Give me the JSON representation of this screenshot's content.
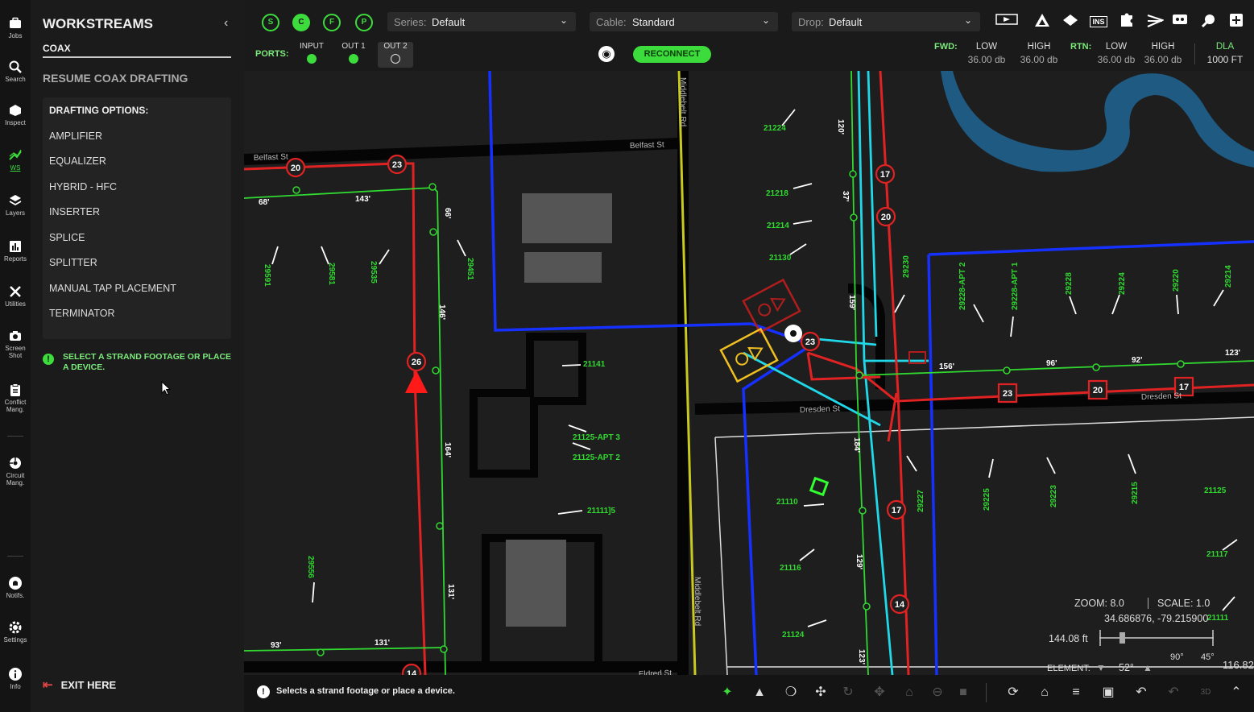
{
  "rail": {
    "items": [
      {
        "key": "jobs",
        "label": "Jobs",
        "icon": "briefcase-icon"
      },
      {
        "key": "search",
        "label": "Search",
        "icon": "search-icon"
      },
      {
        "key": "inspect",
        "label": "Inspect",
        "icon": "inspect-icon"
      },
      {
        "key": "ws",
        "label": "WS",
        "icon": "workstream-icon"
      },
      {
        "key": "layers",
        "label": "Layers",
        "icon": "layers-icon"
      },
      {
        "key": "reports",
        "label": "Reports",
        "icon": "reports-icon"
      },
      {
        "key": "utilities",
        "label": "Utilities",
        "icon": "tools-icon"
      },
      {
        "key": "screenshot",
        "label": "Screen Shot",
        "icon": "camera-icon"
      },
      {
        "key": "conflict",
        "label": "Conflict Mang.",
        "icon": "clipboard-icon"
      },
      {
        "key": "circuit",
        "label": "Circuit Mang.",
        "icon": "circuit-icon"
      },
      {
        "key": "notifs",
        "label": "Notifs.",
        "icon": "bell-icon"
      },
      {
        "key": "settings",
        "label": "Settings",
        "icon": "gear-icon"
      },
      {
        "key": "info",
        "label": "Info",
        "icon": "info-icon"
      }
    ]
  },
  "panel": {
    "title": "WORKSTREAMS",
    "collapse_icon": "chevron-left-icon",
    "subtitle": "COAX",
    "resume": "RESUME COAX DRAFTING",
    "options_heading": "DRAFTING OPTIONS:",
    "options": [
      "AMPLIFIER",
      "EQUALIZER",
      "HYBRID - HFC",
      "INSERTER",
      "SPLICE",
      "SPLITTER",
      "MANUAL TAP PLACEMENT",
      "TERMINATOR"
    ],
    "hint_icon": "!",
    "hint": "SELECT A STRAND FOOTAGE OR PLACE A DEVICE.",
    "exit": "EXIT HERE"
  },
  "toolbar": {
    "modes": [
      "S",
      "C",
      "F",
      "P"
    ],
    "active_mode": "C",
    "series_label": "Series:",
    "series_value": "Default",
    "cable_label": "Cable:",
    "cable_value": "Standard",
    "drop_label": "Drop:",
    "drop_value": "Default",
    "right_icons": [
      "ticket-icon",
      "triangle-icon",
      "diamond-icon",
      "ins-icon",
      "puzzle-icon",
      "lightning-icon",
      "node-icon",
      "wrench-icon",
      "plus-square-icon"
    ],
    "ins_text": "INS"
  },
  "ports": {
    "label": "PORTS:",
    "items": [
      {
        "name": "INPUT",
        "selected": false
      },
      {
        "name": "OUT 1",
        "selected": false
      },
      {
        "name": "OUT 2",
        "selected": true
      }
    ],
    "reconnect": "RECONNECT"
  },
  "levels": {
    "fwd_label": "FWD:",
    "rtn_label": "RTN:",
    "fwd_low_h": "LOW",
    "fwd_low_v": "36.00 db",
    "fwd_high_h": "HIGH",
    "fwd_high_v": "36.00 db",
    "rtn_low_h": "LOW",
    "rtn_low_v": "36.00 db",
    "rtn_high_h": "HIGH",
    "rtn_high_v": "36.00 db",
    "dla_h": "DLA",
    "dla_v": "1000 FT"
  },
  "map": {
    "streets": [
      "Belfast St",
      "Belfast St",
      "Middlebelt Rd",
      "Middlebelt Rd",
      "Dresden St",
      "Dresden St",
      "Eldred St"
    ],
    "address_labels": [
      "21224",
      "21218",
      "21214",
      "21130",
      "21141",
      "21125-APT 3",
      "21125-APT 2",
      "21111]5",
      "21110",
      "21116",
      "21124",
      "29591",
      "29581",
      "29535",
      "29451",
      "29556",
      "29230",
      "29228-APT 2",
      "29228-APT 1",
      "29228",
      "29224",
      "29220",
      "29214",
      "29225",
      "29223",
      "29215",
      "29227",
      "21125",
      "21117",
      "21111"
    ],
    "span_labels": [
      "68'",
      "143'",
      "66'",
      "146'",
      "164'",
      "131'",
      "93'",
      "131'",
      "120'",
      "37'",
      "159'",
      "184'",
      "129'",
      "123'",
      "156'",
      "96'",
      "92'",
      "123'"
    ],
    "tap_values": [
      "20",
      "23",
      "26",
      "14",
      "17",
      "17",
      "20",
      "23",
      "14",
      "23",
      "20",
      "17"
    ],
    "legend": {
      "zoom_label": "ZOOM: 8.0",
      "scale_label": "SCALE: 1.0",
      "coords": "34.686876, -79.215900",
      "scale_distance": "144.08 ft",
      "element_label": "ELEMENT:",
      "element_value": "52°",
      "angle1": "90°",
      "angle2": "45°",
      "elev": "116.82"
    }
  },
  "status": {
    "icon": "!",
    "text": "Selects a strand footage or place a device.",
    "icons": [
      "select-icon",
      "shapes-icon",
      "lasso-icon",
      "crosshair-icon",
      "rotate-icon",
      "move-icon",
      "building-icon",
      "minus-circle-icon",
      "trash-icon",
      "refresh-icon",
      "home-icon",
      "list-add-icon",
      "screen-icon",
      "undo-icon",
      "redo-icon",
      "3d-icon",
      "chevron-up-icon"
    ]
  }
}
